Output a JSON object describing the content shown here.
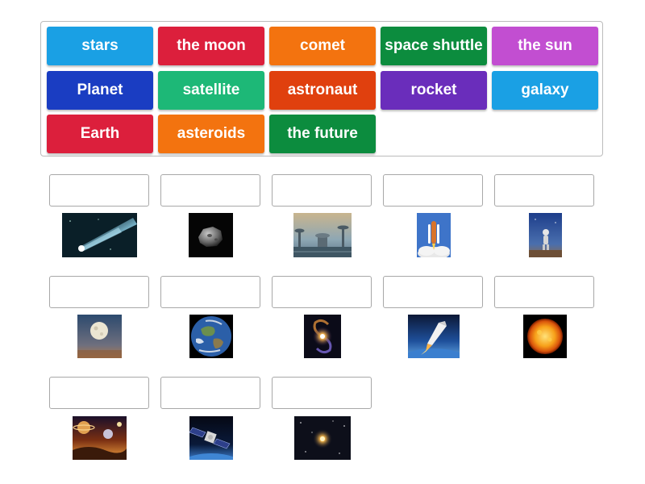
{
  "word_bank": {
    "items": [
      {
        "label": "stars",
        "color": "#1aa0e4"
      },
      {
        "label": "the moon",
        "color": "#dc1f3c"
      },
      {
        "label": "comet",
        "color": "#f3730f"
      },
      {
        "label": "space shuttle",
        "color": "#0c8c3e"
      },
      {
        "label": "the sun",
        "color": "#c24ed1"
      },
      {
        "label": "Planet",
        "color": "#1a3dc2"
      },
      {
        "label": "satellite",
        "color": "#1db877"
      },
      {
        "label": "astronaut",
        "color": "#e0400e"
      },
      {
        "label": "rocket",
        "color": "#6a2dbb"
      },
      {
        "label": "galaxy",
        "color": "#1aa0e4"
      },
      {
        "label": "Earth",
        "color": "#dc1f3c"
      },
      {
        "label": "asteroids",
        "color": "#f3730f"
      },
      {
        "label": "the future",
        "color": "#0c8c3e"
      }
    ]
  },
  "matches": [
    {
      "picture": "comet-picture",
      "answer": ""
    },
    {
      "picture": "asteroid-picture",
      "answer": ""
    },
    {
      "picture": "future-city-picture",
      "answer": ""
    },
    {
      "picture": "space-shuttle-launch-picture",
      "answer": ""
    },
    {
      "picture": "astronaut-picture",
      "answer": ""
    },
    {
      "picture": "moon-picture",
      "answer": ""
    },
    {
      "picture": "earth-picture",
      "answer": ""
    },
    {
      "picture": "galaxy-picture",
      "answer": ""
    },
    {
      "picture": "rocket-launch-picture",
      "answer": ""
    },
    {
      "picture": "sun-picture",
      "answer": ""
    },
    {
      "picture": "planets-picture",
      "answer": ""
    },
    {
      "picture": "satellite-picture",
      "answer": ""
    },
    {
      "picture": "star-picture",
      "answer": ""
    }
  ]
}
